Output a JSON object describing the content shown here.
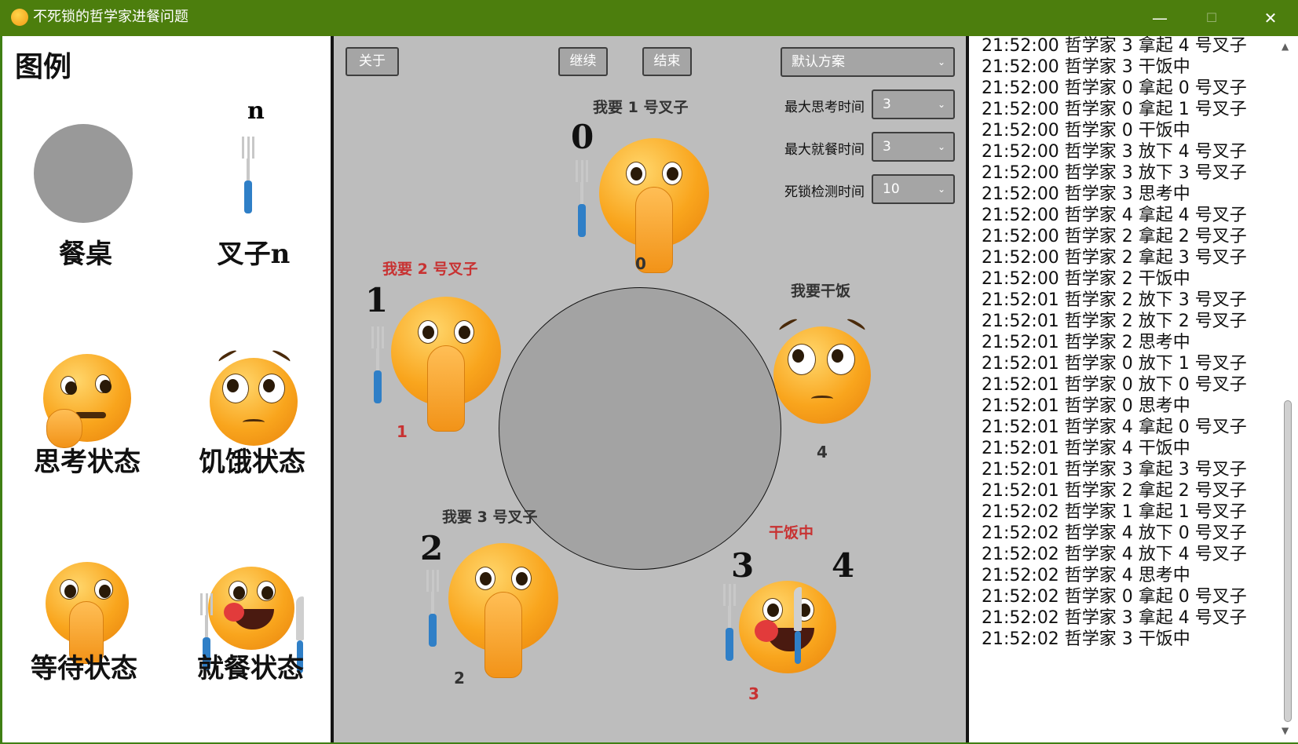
{
  "window": {
    "title": "不死锁的哲学家进餐问题",
    "min_glyph": "—",
    "max_glyph": "☐",
    "close_glyph": "✕"
  },
  "legend": {
    "title": "图例",
    "fork_number": "n",
    "items": [
      {
        "label": "餐桌",
        "icon": "table-icon"
      },
      {
        "label": "叉子n",
        "icon": "fork-icon"
      },
      {
        "label": "思考状态",
        "icon": "thinking-face-icon"
      },
      {
        "label": "饥饿状态",
        "icon": "pleading-face-icon"
      },
      {
        "label": "等待状态",
        "icon": "praying-face-icon"
      },
      {
        "label": "就餐状态",
        "icon": "eating-face-icon"
      }
    ]
  },
  "controls": {
    "about": "关于",
    "continue": "继续",
    "end": "结束",
    "preset": "默认方案",
    "max_think_label": "最大思考时间",
    "max_think_value": "3",
    "max_eat_label": "最大就餐时间",
    "max_eat_value": "3",
    "deadlock_label": "死锁检测时间",
    "deadlock_value": "10"
  },
  "philosophers": [
    {
      "id": "0",
      "speech": "我要 1 号叉子",
      "state": "waiting",
      "fork": "0"
    },
    {
      "id": "1",
      "speech": "我要 2 号叉子",
      "state": "waiting",
      "fork": "1"
    },
    {
      "id": "2",
      "speech": "我要 3 号叉子",
      "state": "waiting",
      "fork": "2"
    },
    {
      "id": "3",
      "speech": "干饭中",
      "state": "eating",
      "fork_left": "3",
      "fork_right": "4"
    },
    {
      "id": "4",
      "speech": "我要干饭",
      "state": "hungry"
    }
  ],
  "colors": {
    "titlebar": "#4c7e0d",
    "canvas": "#bdbdbd",
    "table": "#a3a3a3",
    "speech_normal": "#333333",
    "speech_red": "#c83232",
    "fork_handle": "#2f7fc7"
  },
  "log": [
    "21:52:00 哲学家 3 拿起 4 号叉子",
    "21:52:00 哲学家 3 干饭中",
    "21:52:00 哲学家 0 拿起 0 号叉子",
    "21:52:00 哲学家 0 拿起 1 号叉子",
    "21:52:00 哲学家 0 干饭中",
    "21:52:00 哲学家 3 放下 4 号叉子",
    "21:52:00 哲学家 3 放下 3 号叉子",
    "21:52:00 哲学家 3 思考中",
    "21:52:00 哲学家 4 拿起 4 号叉子",
    "21:52:00 哲学家 2 拿起 2 号叉子",
    "21:52:00 哲学家 2 拿起 3 号叉子",
    "21:52:00 哲学家 2 干饭中",
    "21:52:01 哲学家 2 放下 3 号叉子",
    "21:52:01 哲学家 2 放下 2 号叉子",
    "21:52:01 哲学家 2 思考中",
    "21:52:01 哲学家 0 放下 1 号叉子",
    "21:52:01 哲学家 0 放下 0 号叉子",
    "21:52:01 哲学家 0 思考中",
    "21:52:01 哲学家 4 拿起 0 号叉子",
    "21:52:01 哲学家 4 干饭中",
    "21:52:01 哲学家 3 拿起 3 号叉子",
    "21:52:01 哲学家 2 拿起 2 号叉子",
    "21:52:02 哲学家 1 拿起 1 号叉子",
    "21:52:02 哲学家 4 放下 0 号叉子",
    "21:52:02 哲学家 4 放下 4 号叉子",
    "21:52:02 哲学家 4 思考中",
    "21:52:02 哲学家 0 拿起 0 号叉子",
    "21:52:02 哲学家 3 拿起 4 号叉子",
    "21:52:02 哲学家 3 干饭中"
  ]
}
